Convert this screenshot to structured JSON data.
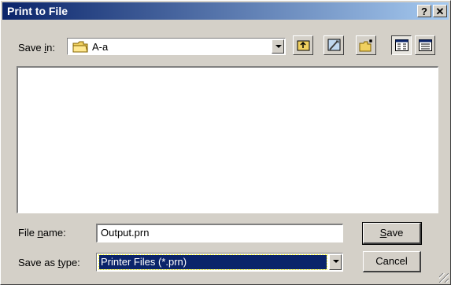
{
  "window": {
    "title": "Print to File"
  },
  "titlebar_buttons": {
    "help": "?",
    "close": "✕"
  },
  "save_in": {
    "label_prefix": "Save ",
    "label_accel": "i",
    "label_suffix": "n:",
    "value": "A-a"
  },
  "toolbar": {
    "icons": [
      "up-one-level-icon",
      "desktop-icon",
      "create-new-folder-icon",
      "list-view-icon",
      "details-view-icon"
    ]
  },
  "file_name": {
    "label_prefix": "File ",
    "label_accel": "n",
    "label_suffix": "ame:",
    "value": "Output.prn"
  },
  "save_as_type": {
    "label_prefix": "Save as ",
    "label_accel": "t",
    "label_suffix": "ype:",
    "value": "Printer Files (*.prn)"
  },
  "buttons": {
    "save_accel": "S",
    "save_rest": "ave",
    "cancel": "Cancel"
  },
  "colors": {
    "title_start": "#0a246a",
    "title_end": "#a6caf0",
    "face": "#d4d0c8",
    "selection": "#0a246a"
  }
}
